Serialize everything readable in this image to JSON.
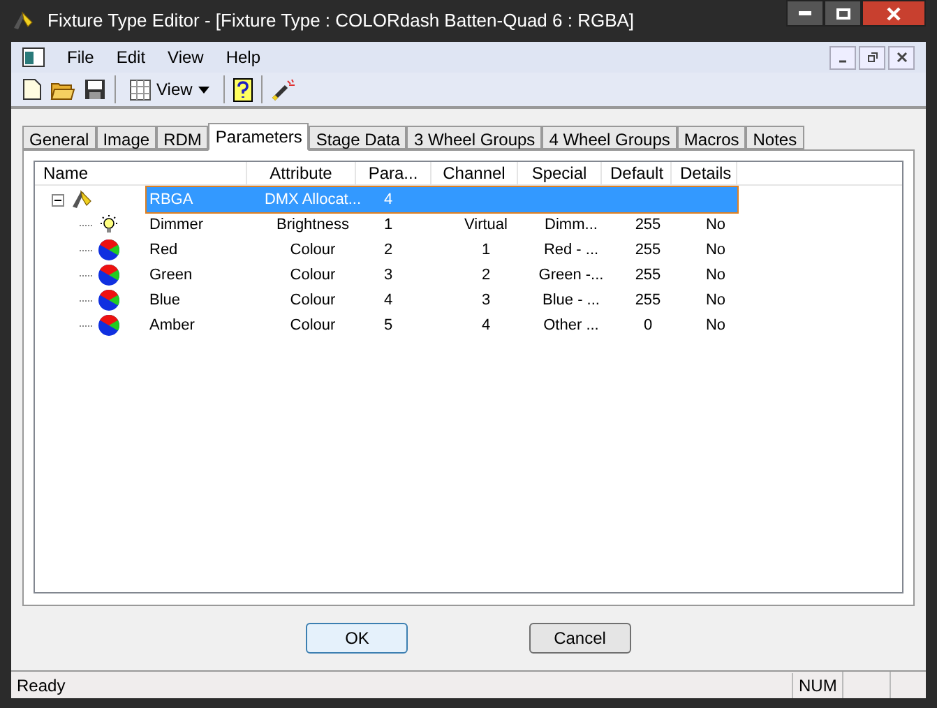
{
  "window": {
    "title": "Fixture Type Editor - [Fixture Type : COLORdash Batten-Quad 6 : RGBA]"
  },
  "menu": [
    "File",
    "Edit",
    "View",
    "Help"
  ],
  "toolbar": {
    "view_label": "View"
  },
  "tabs": [
    {
      "label": "General",
      "selected": false
    },
    {
      "label": "Image",
      "selected": false
    },
    {
      "label": "RDM",
      "selected": false
    },
    {
      "label": "Parameters",
      "selected": true
    },
    {
      "label": "Stage Data",
      "selected": false
    },
    {
      "label": "3 Wheel Groups",
      "selected": false
    },
    {
      "label": "4 Wheel Groups",
      "selected": false
    },
    {
      "label": "Macros",
      "selected": false
    },
    {
      "label": "Notes",
      "selected": false
    }
  ],
  "table": {
    "columns": [
      "Name",
      "Attribute",
      "Para...",
      "Channel",
      "Special",
      "Default",
      "Details"
    ],
    "rows": [
      {
        "kind": "fixture",
        "expanded": true,
        "selected": true,
        "cells": [
          "RBGA",
          "DMX Allocat...",
          "4",
          "",
          "",
          "",
          ""
        ],
        "children": [
          {
            "kind": "dimmer",
            "selected": false,
            "cells": [
              "Dimmer",
              "Brightness",
              "1",
              "Virtual",
              "Dimm...",
              "255",
              "No"
            ]
          },
          {
            "kind": "colour",
            "selected": false,
            "cells": [
              "Red",
              "Colour",
              "2",
              "1",
              "Red - ...",
              "255",
              "No"
            ]
          },
          {
            "kind": "colour",
            "selected": false,
            "cells": [
              "Green",
              "Colour",
              "3",
              "2",
              "Green -...",
              "255",
              "No"
            ]
          },
          {
            "kind": "colour",
            "selected": false,
            "cells": [
              "Blue",
              "Colour",
              "4",
              "3",
              "Blue - ...",
              "255",
              "No"
            ]
          },
          {
            "kind": "colour",
            "selected": false,
            "cells": [
              "Amber",
              "Colour",
              "5",
              "4",
              "Other ...",
              "0",
              "No"
            ]
          }
        ]
      }
    ]
  },
  "buttons": [
    "OK",
    "Cancel"
  ],
  "status_bar": {
    "message": "Ready",
    "indicator": "NUM"
  }
}
